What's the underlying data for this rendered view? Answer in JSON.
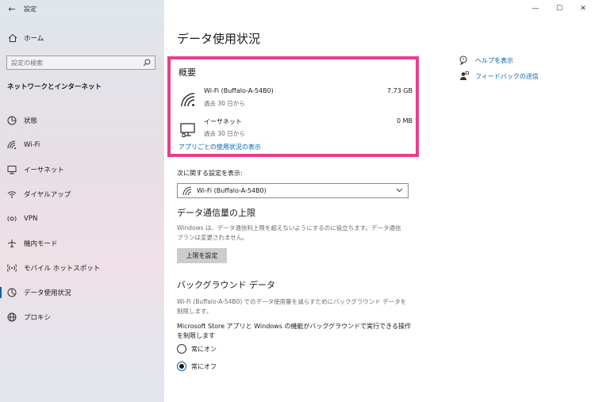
{
  "window": {
    "title": "設定",
    "back_icon": "←",
    "minimize": "—",
    "maximize": "☐",
    "close": "✕"
  },
  "sidebar": {
    "home_label": "ホーム",
    "search_placeholder": "設定の検索",
    "section_title": "ネットワークとインターネット",
    "items": [
      {
        "label": "状態",
        "icon": "status-icon"
      },
      {
        "label": "Wi-Fi",
        "icon": "wifi-icon"
      },
      {
        "label": "イーサネット",
        "icon": "ethernet-icon"
      },
      {
        "label": "ダイヤルアップ",
        "icon": "dialup-icon"
      },
      {
        "label": "VPN",
        "icon": "vpn-icon"
      },
      {
        "label": "機内モード",
        "icon": "airplane-icon"
      },
      {
        "label": "モバイル ホットスポット",
        "icon": "hotspot-icon"
      },
      {
        "label": "データ使用状況",
        "icon": "data-usage-icon",
        "active": true
      },
      {
        "label": "プロキシ",
        "icon": "globe-icon"
      }
    ]
  },
  "main": {
    "page_title": "データ使用状況",
    "overview": {
      "title": "概要",
      "rows": [
        {
          "name": "Wi-Fi (Buffalo-A-54B0)",
          "sub": "過去 30 日から",
          "size": "7.73 GB"
        },
        {
          "name": "イーサネット",
          "sub": "過去 30 日から",
          "size": "0 MB"
        }
      ],
      "link": "アプリごとの使用状況の表示"
    },
    "show_settings_label": "次に関する設定を表示:",
    "select_value": "Wi-Fi (Buffalo-A-54B0)",
    "data_limit": {
      "title": "データ通信量の上限",
      "desc_line1": "Windows は、データ通信料上限を超えないようにするのに役立ちます。データ通信",
      "desc_line2": "プランは変更されません。",
      "button": "上限を設定"
    },
    "background": {
      "title": "バックグラウンド データ",
      "desc_line1": "Wi-Fi (Buffalo-A-54B0) でのデータ使用量を減らすためにバックグラウンド データを",
      "desc_line2": "制限します。",
      "question_line1": "Microsoft Store アプリと Windows の機能がバックグラウンドで実行できる操作",
      "question_line2": "を制限します",
      "options": [
        "常にオン",
        "常にオフ"
      ]
    },
    "help_links": {
      "help": "ヘルプを表示",
      "feedback": "フィードバックの送信"
    }
  },
  "colors": {
    "accent": "#0063b1",
    "highlight": "#e83e8c"
  }
}
